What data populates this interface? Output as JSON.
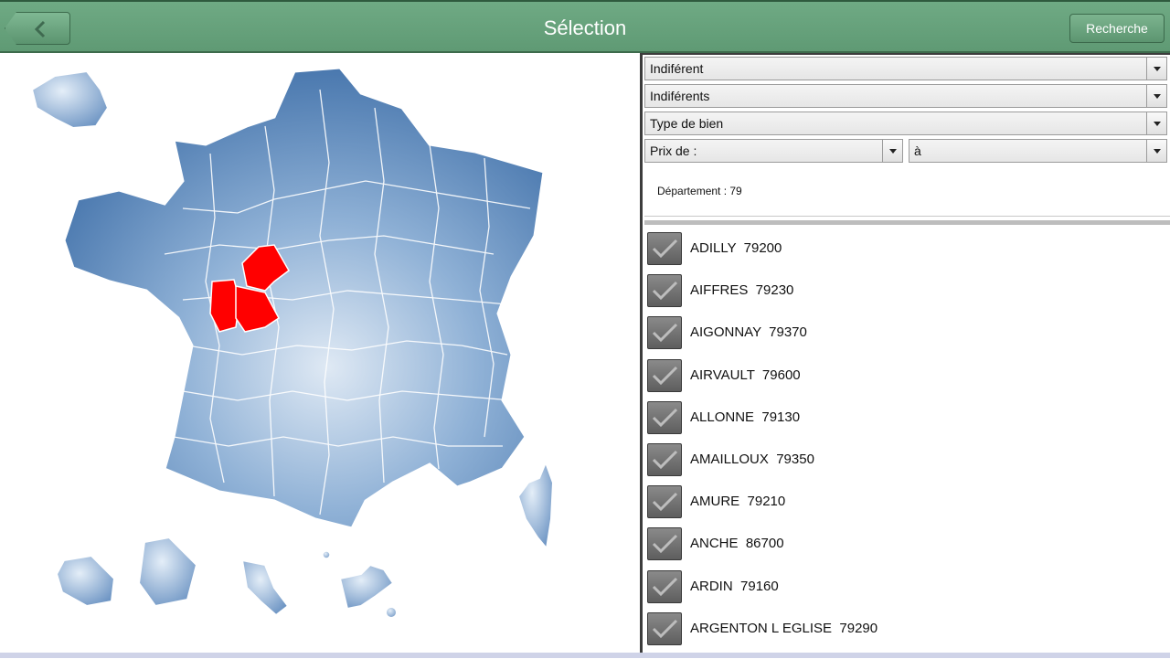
{
  "header": {
    "title": "Sélection",
    "search_label": "Recherche"
  },
  "filters": {
    "select1": "Indiférent",
    "select2": "Indiférents",
    "select3": "Type de bien",
    "price_from": "Prix de :",
    "price_to": "à"
  },
  "department": {
    "label": "Département : 79"
  },
  "communes": [
    {
      "label": "ADILLY  79200"
    },
    {
      "label": "AIFFRES  79230"
    },
    {
      "label": "AIGONNAY  79370"
    },
    {
      "label": "AIRVAULT  79600"
    },
    {
      "label": "ALLONNE  79130"
    },
    {
      "label": "AMAILLOUX  79350"
    },
    {
      "label": "AMURE  79210"
    },
    {
      "label": "ANCHE  86700"
    },
    {
      "label": "ARDIN  79160"
    },
    {
      "label": "ARGENTON L EGLISE  79290"
    }
  ],
  "colors": {
    "header_green": "#6aa57e",
    "map_blue": "#6f98c6",
    "selected_region": "#ff0000"
  }
}
